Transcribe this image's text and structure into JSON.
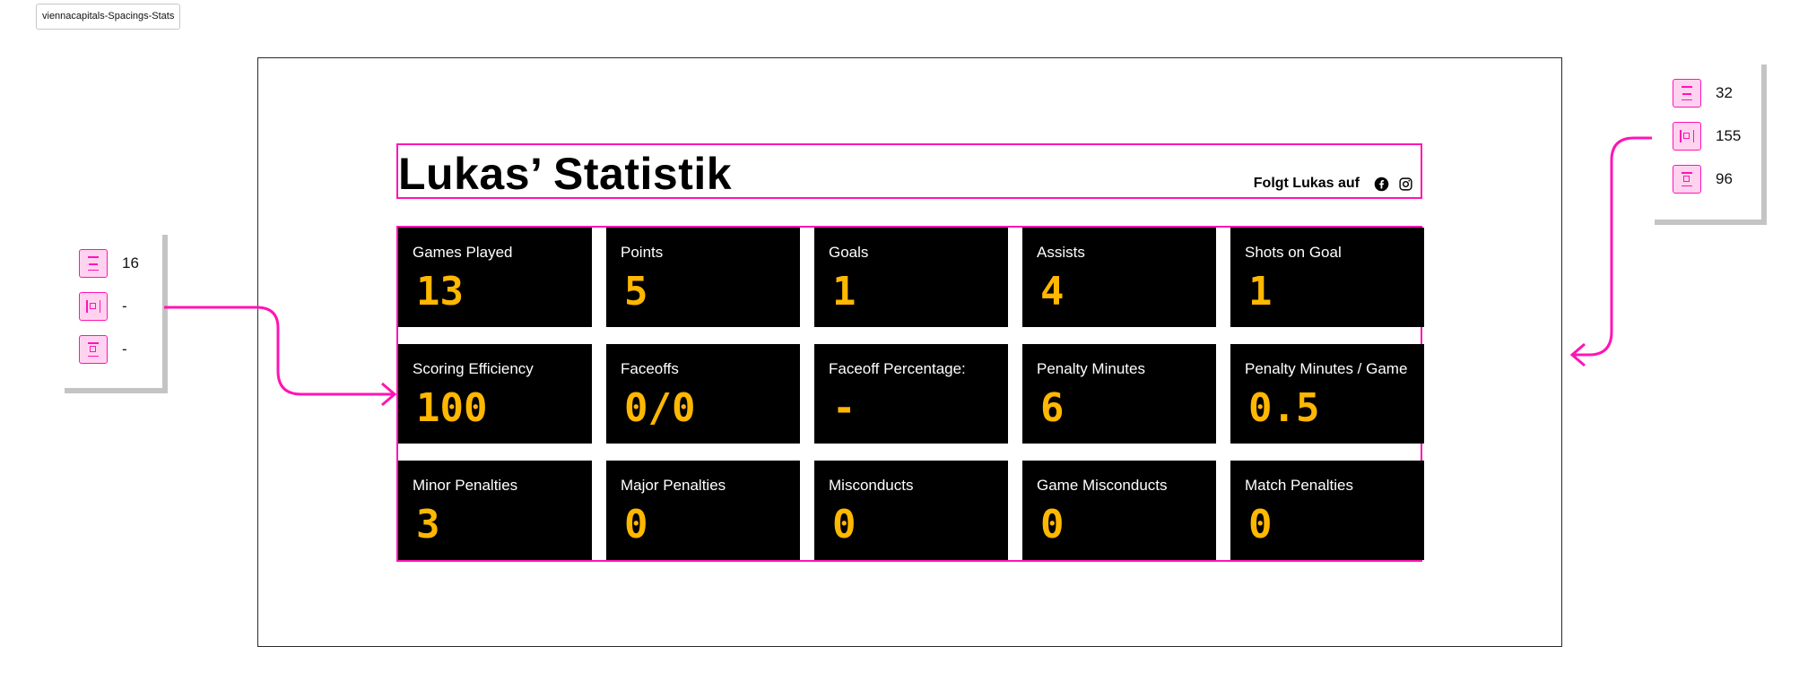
{
  "frame_tag": "viennacapitals-Spacings-Stats",
  "title": "Lukas’ Statistik",
  "follow_label": "Folgt Lukas auf",
  "social": [
    "facebook-icon",
    "instagram-icon"
  ],
  "stats": [
    {
      "label": "Games Played",
      "value": "13"
    },
    {
      "label": "Points",
      "value": "5"
    },
    {
      "label": "Goals",
      "value": "1"
    },
    {
      "label": "Assists",
      "value": "4"
    },
    {
      "label": "Shots on Goal",
      "value": "1"
    },
    {
      "label": "Scoring Efficiency",
      "value": "100"
    },
    {
      "label": "Faceoffs",
      "value": "0/0"
    },
    {
      "label": "Faceoff Percentage:",
      "value": "-"
    },
    {
      "label": "Penalty Minutes",
      "value": "6"
    },
    {
      "label": "Penalty Minutes / Game",
      "value": "0.5"
    },
    {
      "label": "Minor Penalties",
      "value": "3"
    },
    {
      "label": "Major Penalties",
      "value": "0"
    },
    {
      "label": "Misconducts",
      "value": "0"
    },
    {
      "label": "Game Misconducts",
      "value": "0"
    },
    {
      "label": "Match Penalties",
      "value": "0"
    }
  ],
  "spacing_left": {
    "gap": "16",
    "padding": "-",
    "margin": "-"
  },
  "spacing_right": {
    "gap": "32",
    "padding": "155",
    "margin": "96"
  },
  "colors": {
    "accent": "#ff14b4",
    "value": "#ffb700",
    "tile": "#000000"
  }
}
